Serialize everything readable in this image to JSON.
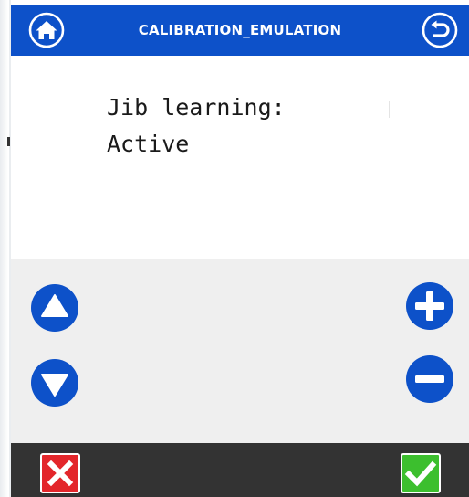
{
  "header": {
    "title": "CALIBRATION_EMULATION",
    "home_icon": "home-icon",
    "back_icon": "back-arrow-icon"
  },
  "content": {
    "line1": "Jib learning:",
    "line2": "Active"
  },
  "controls": {
    "up_icon": "triangle-up-icon",
    "down_icon": "triangle-down-icon",
    "plus_icon": "plus-icon",
    "minus_icon": "minus-icon"
  },
  "footer": {
    "cancel_icon": "x-icon",
    "confirm_icon": "checkmark-icon"
  },
  "colors": {
    "header_blue": "#0d51c9",
    "button_blue": "#0d51c9",
    "controls_bg": "#efefef",
    "footer_bg": "#333333",
    "cancel_red": "#e3262b",
    "confirm_green": "#3cbf2e"
  }
}
